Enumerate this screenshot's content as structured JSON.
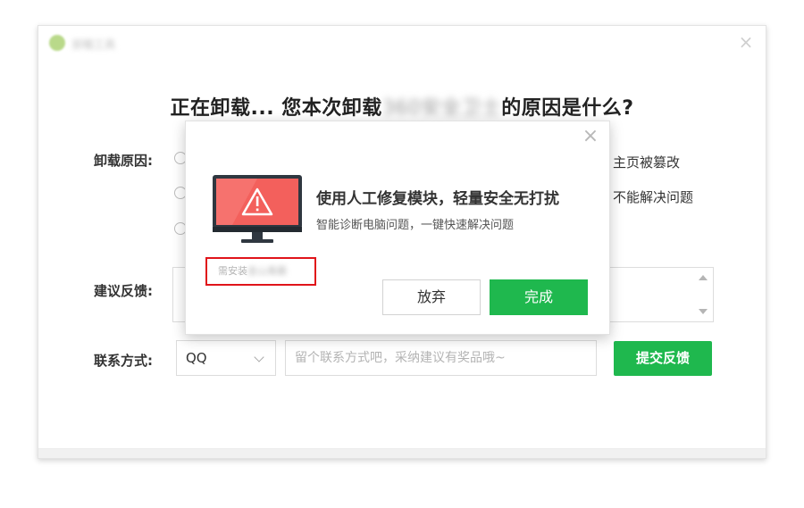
{
  "window": {
    "app_name": "卸载工具",
    "close_glyph": "×"
  },
  "headline": {
    "prefix": "正在卸载... 您本次卸载",
    "blurred_product": "360安全卫士",
    "suffix": "的原因是什么?"
  },
  "form": {
    "reason_label": "卸载原因:",
    "reasons_right": [
      "主页被篡改",
      "不能解决问题"
    ],
    "feedback_label": "建议反馈:",
    "contact_label": "联系方式:",
    "contact_type_selected": "QQ",
    "contact_placeholder": "留个联系方式吧，采纳建议有奖品哦~",
    "submit_label": "提交反馈"
  },
  "modal": {
    "close_glyph": "×",
    "title": "使用人工修复模块，轻量安全无打扰",
    "subtitle": "智能诊断电脑问题，一键快速解决问题",
    "install_note_prefix": "需安装",
    "install_note_blurred": "金山毒霸",
    "cancel_label": "放弃",
    "confirm_label": "完成"
  },
  "colors": {
    "accent_green": "#1fb84e",
    "highlight_red": "#e0141a",
    "warning_red": "#f3605c"
  }
}
